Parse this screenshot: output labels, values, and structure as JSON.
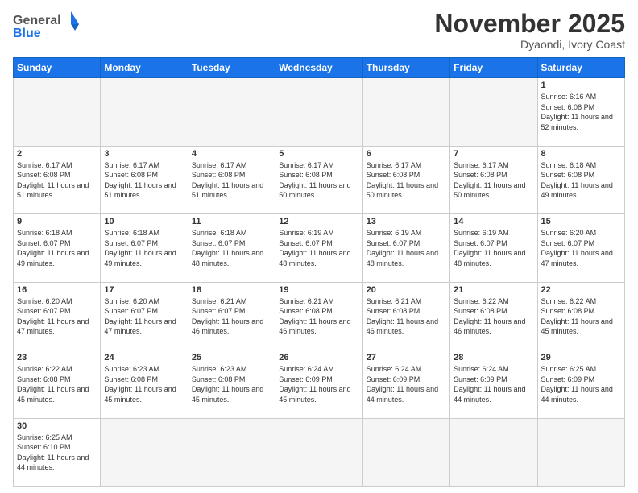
{
  "header": {
    "logo_general": "General",
    "logo_blue": "Blue",
    "month_title": "November 2025",
    "location": "Dyaondi, Ivory Coast"
  },
  "weekdays": [
    "Sunday",
    "Monday",
    "Tuesday",
    "Wednesday",
    "Thursday",
    "Friday",
    "Saturday"
  ],
  "weeks": [
    [
      {
        "day": "",
        "empty": true
      },
      {
        "day": "",
        "empty": true
      },
      {
        "day": "",
        "empty": true
      },
      {
        "day": "",
        "empty": true
      },
      {
        "day": "",
        "empty": true
      },
      {
        "day": "",
        "empty": true
      },
      {
        "day": "1",
        "sunrise": "Sunrise: 6:16 AM",
        "sunset": "Sunset: 6:08 PM",
        "daylight": "Daylight: 11 hours and 52 minutes."
      }
    ],
    [
      {
        "day": "2",
        "sunrise": "Sunrise: 6:17 AM",
        "sunset": "Sunset: 6:08 PM",
        "daylight": "Daylight: 11 hours and 51 minutes."
      },
      {
        "day": "3",
        "sunrise": "Sunrise: 6:17 AM",
        "sunset": "Sunset: 6:08 PM",
        "daylight": "Daylight: 11 hours and 51 minutes."
      },
      {
        "day": "4",
        "sunrise": "Sunrise: 6:17 AM",
        "sunset": "Sunset: 6:08 PM",
        "daylight": "Daylight: 11 hours and 51 minutes."
      },
      {
        "day": "5",
        "sunrise": "Sunrise: 6:17 AM",
        "sunset": "Sunset: 6:08 PM",
        "daylight": "Daylight: 11 hours and 50 minutes."
      },
      {
        "day": "6",
        "sunrise": "Sunrise: 6:17 AM",
        "sunset": "Sunset: 6:08 PM",
        "daylight": "Daylight: 11 hours and 50 minutes."
      },
      {
        "day": "7",
        "sunrise": "Sunrise: 6:17 AM",
        "sunset": "Sunset: 6:08 PM",
        "daylight": "Daylight: 11 hours and 50 minutes."
      },
      {
        "day": "8",
        "sunrise": "Sunrise: 6:18 AM",
        "sunset": "Sunset: 6:08 PM",
        "daylight": "Daylight: 11 hours and 49 minutes."
      }
    ],
    [
      {
        "day": "9",
        "sunrise": "Sunrise: 6:18 AM",
        "sunset": "Sunset: 6:07 PM",
        "daylight": "Daylight: 11 hours and 49 minutes."
      },
      {
        "day": "10",
        "sunrise": "Sunrise: 6:18 AM",
        "sunset": "Sunset: 6:07 PM",
        "daylight": "Daylight: 11 hours and 49 minutes."
      },
      {
        "day": "11",
        "sunrise": "Sunrise: 6:18 AM",
        "sunset": "Sunset: 6:07 PM",
        "daylight": "Daylight: 11 hours and 48 minutes."
      },
      {
        "day": "12",
        "sunrise": "Sunrise: 6:19 AM",
        "sunset": "Sunset: 6:07 PM",
        "daylight": "Daylight: 11 hours and 48 minutes."
      },
      {
        "day": "13",
        "sunrise": "Sunrise: 6:19 AM",
        "sunset": "Sunset: 6:07 PM",
        "daylight": "Daylight: 11 hours and 48 minutes."
      },
      {
        "day": "14",
        "sunrise": "Sunrise: 6:19 AM",
        "sunset": "Sunset: 6:07 PM",
        "daylight": "Daylight: 11 hours and 48 minutes."
      },
      {
        "day": "15",
        "sunrise": "Sunrise: 6:20 AM",
        "sunset": "Sunset: 6:07 PM",
        "daylight": "Daylight: 11 hours and 47 minutes."
      }
    ],
    [
      {
        "day": "16",
        "sunrise": "Sunrise: 6:20 AM",
        "sunset": "Sunset: 6:07 PM",
        "daylight": "Daylight: 11 hours and 47 minutes."
      },
      {
        "day": "17",
        "sunrise": "Sunrise: 6:20 AM",
        "sunset": "Sunset: 6:07 PM",
        "daylight": "Daylight: 11 hours and 47 minutes."
      },
      {
        "day": "18",
        "sunrise": "Sunrise: 6:21 AM",
        "sunset": "Sunset: 6:07 PM",
        "daylight": "Daylight: 11 hours and 46 minutes."
      },
      {
        "day": "19",
        "sunrise": "Sunrise: 6:21 AM",
        "sunset": "Sunset: 6:08 PM",
        "daylight": "Daylight: 11 hours and 46 minutes."
      },
      {
        "day": "20",
        "sunrise": "Sunrise: 6:21 AM",
        "sunset": "Sunset: 6:08 PM",
        "daylight": "Daylight: 11 hours and 46 minutes."
      },
      {
        "day": "21",
        "sunrise": "Sunrise: 6:22 AM",
        "sunset": "Sunset: 6:08 PM",
        "daylight": "Daylight: 11 hours and 46 minutes."
      },
      {
        "day": "22",
        "sunrise": "Sunrise: 6:22 AM",
        "sunset": "Sunset: 6:08 PM",
        "daylight": "Daylight: 11 hours and 45 minutes."
      }
    ],
    [
      {
        "day": "23",
        "sunrise": "Sunrise: 6:22 AM",
        "sunset": "Sunset: 6:08 PM",
        "daylight": "Daylight: 11 hours and 45 minutes."
      },
      {
        "day": "24",
        "sunrise": "Sunrise: 6:23 AM",
        "sunset": "Sunset: 6:08 PM",
        "daylight": "Daylight: 11 hours and 45 minutes."
      },
      {
        "day": "25",
        "sunrise": "Sunrise: 6:23 AM",
        "sunset": "Sunset: 6:08 PM",
        "daylight": "Daylight: 11 hours and 45 minutes."
      },
      {
        "day": "26",
        "sunrise": "Sunrise: 6:24 AM",
        "sunset": "Sunset: 6:09 PM",
        "daylight": "Daylight: 11 hours and 45 minutes."
      },
      {
        "day": "27",
        "sunrise": "Sunrise: 6:24 AM",
        "sunset": "Sunset: 6:09 PM",
        "daylight": "Daylight: 11 hours and 44 minutes."
      },
      {
        "day": "28",
        "sunrise": "Sunrise: 6:24 AM",
        "sunset": "Sunset: 6:09 PM",
        "daylight": "Daylight: 11 hours and 44 minutes."
      },
      {
        "day": "29",
        "sunrise": "Sunrise: 6:25 AM",
        "sunset": "Sunset: 6:09 PM",
        "daylight": "Daylight: 11 hours and 44 minutes."
      }
    ],
    [
      {
        "day": "30",
        "sunrise": "Sunrise: 6:25 AM",
        "sunset": "Sunset: 6:10 PM",
        "daylight": "Daylight: 11 hours and 44 minutes."
      },
      {
        "day": "",
        "empty": true
      },
      {
        "day": "",
        "empty": true
      },
      {
        "day": "",
        "empty": true
      },
      {
        "day": "",
        "empty": true
      },
      {
        "day": "",
        "empty": true
      },
      {
        "day": "",
        "empty": true
      }
    ]
  ]
}
